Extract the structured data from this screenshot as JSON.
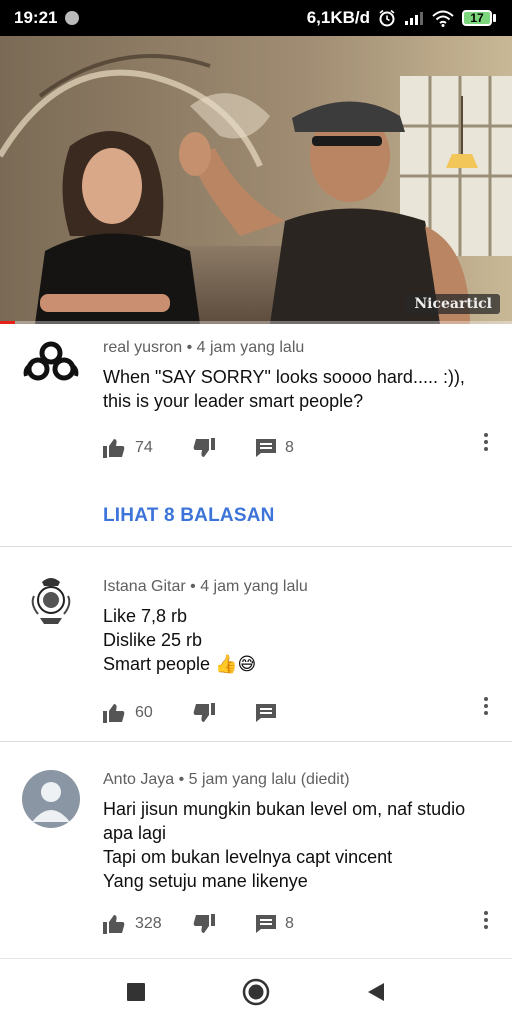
{
  "status_bar": {
    "time": "19:21",
    "network_speed": "6,1KB/d",
    "battery_level": "17",
    "icons": [
      "notification-dot-icon",
      "alarm-icon",
      "signal-icon",
      "wifi-icon",
      "battery-icon"
    ]
  },
  "video": {
    "watermark": "Nicearticl",
    "progress_fraction": 0.03,
    "progress_color": "#e62117"
  },
  "comments": [
    {
      "author": "real yusron",
      "time": "4 jam yang lalu",
      "text": "When \"SAY SORRY\" looks soooo hard..... :)), this is your leader smart people?",
      "likes": "74",
      "replies": "8",
      "view_replies": "LIHAT 8 BALASAN",
      "avatar_icon": "cloud9-logo-icon"
    },
    {
      "author": "Istana Gitar",
      "time": "4 jam yang lalu",
      "lines": [
        "Like 7,8 rb",
        "Dislike 25 rb",
        "Smart people"
      ],
      "emoji": [
        "👍",
        "😅"
      ],
      "likes": "60",
      "avatar_icon": "crest-emblem-icon"
    },
    {
      "author": "Anto Jaya",
      "time": "5 jam yang lalu (diedit)",
      "lines": [
        "Hari jisun mungkin bukan level om, naf studio apa lagi",
        "Tapi om bukan levelnya  capt vincent",
        "Yang setuju mane likenye"
      ],
      "likes": "328",
      "replies": "8",
      "avatar_icon": "default-user-avatar-icon"
    }
  ],
  "colors": {
    "link_blue": "#3d74d9",
    "meta_gray": "#606060",
    "divider": "#dcdcdc"
  },
  "nav": {
    "icons": [
      "recent-apps-icon",
      "home-icon",
      "back-icon"
    ]
  }
}
